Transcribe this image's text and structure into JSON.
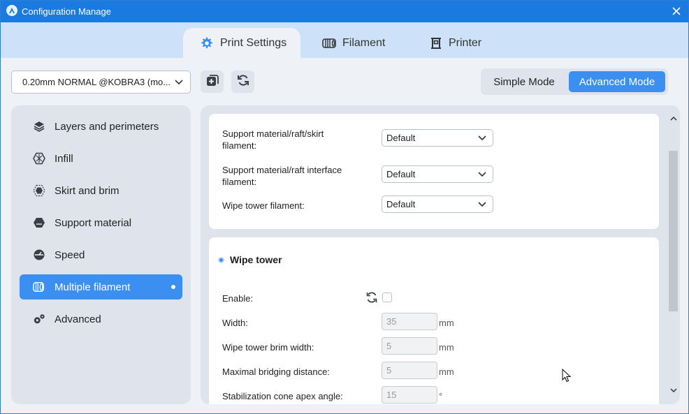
{
  "window": {
    "title": "Configuration Manage"
  },
  "tabs": [
    {
      "label": "Print Settings",
      "icon": "gear-icon",
      "active": true
    },
    {
      "label": "Filament",
      "icon": "filament-spool-icon",
      "active": false
    },
    {
      "label": "Printer",
      "icon": "printer-icon",
      "active": false
    }
  ],
  "toolbar": {
    "preset": "0.20mm NORMAL @KOBRA3 (mo...",
    "copy_icon": "copy-add-icon",
    "reset_icon": "refresh-icon"
  },
  "mode": {
    "simple": "Simple Mode",
    "advanced": "Advanced Mode",
    "selected": "Advanced Mode"
  },
  "sidebar": {
    "items": [
      {
        "label": "Layers and perimeters",
        "icon": "layers-icon"
      },
      {
        "label": "Infill",
        "icon": "infill-icon"
      },
      {
        "label": "Skirt and brim",
        "icon": "skirt-brim-icon"
      },
      {
        "label": "Support material",
        "icon": "support-icon"
      },
      {
        "label": "Speed",
        "icon": "speedometer-icon"
      },
      {
        "label": "Multiple filament",
        "icon": "multi-filament-icon",
        "active": true
      },
      {
        "label": "Advanced",
        "icon": "gears-icon"
      }
    ]
  },
  "extruders": {
    "support_raft_skirt": {
      "label_line1": "Support material/raft/skirt",
      "label_line2": "filament:",
      "value": "Default"
    },
    "support_interface": {
      "label_line1": "Support material/raft interface",
      "label_line2": "filament:",
      "value": "Default"
    },
    "wipe_tower_filament": {
      "label": "Wipe tower filament:",
      "value": "Default"
    }
  },
  "wipe_tower": {
    "title": "Wipe tower",
    "enable": {
      "label": "Enable:",
      "checked": false
    },
    "width": {
      "label": "Width:",
      "value": "35",
      "unit": "mm"
    },
    "brim_width": {
      "label": "Wipe tower brim width:",
      "value": "5",
      "unit": "mm"
    },
    "bridging": {
      "label": "Maximal bridging distance:",
      "value": "5",
      "unit": "mm"
    },
    "cone_angle": {
      "label": "Stabilization cone apex angle:",
      "value": "15",
      "unit": "°"
    }
  },
  "colors": {
    "accent": "#3b8ff0",
    "titlebar": "#1a7ae0",
    "tabbar": "#cde2f8"
  }
}
